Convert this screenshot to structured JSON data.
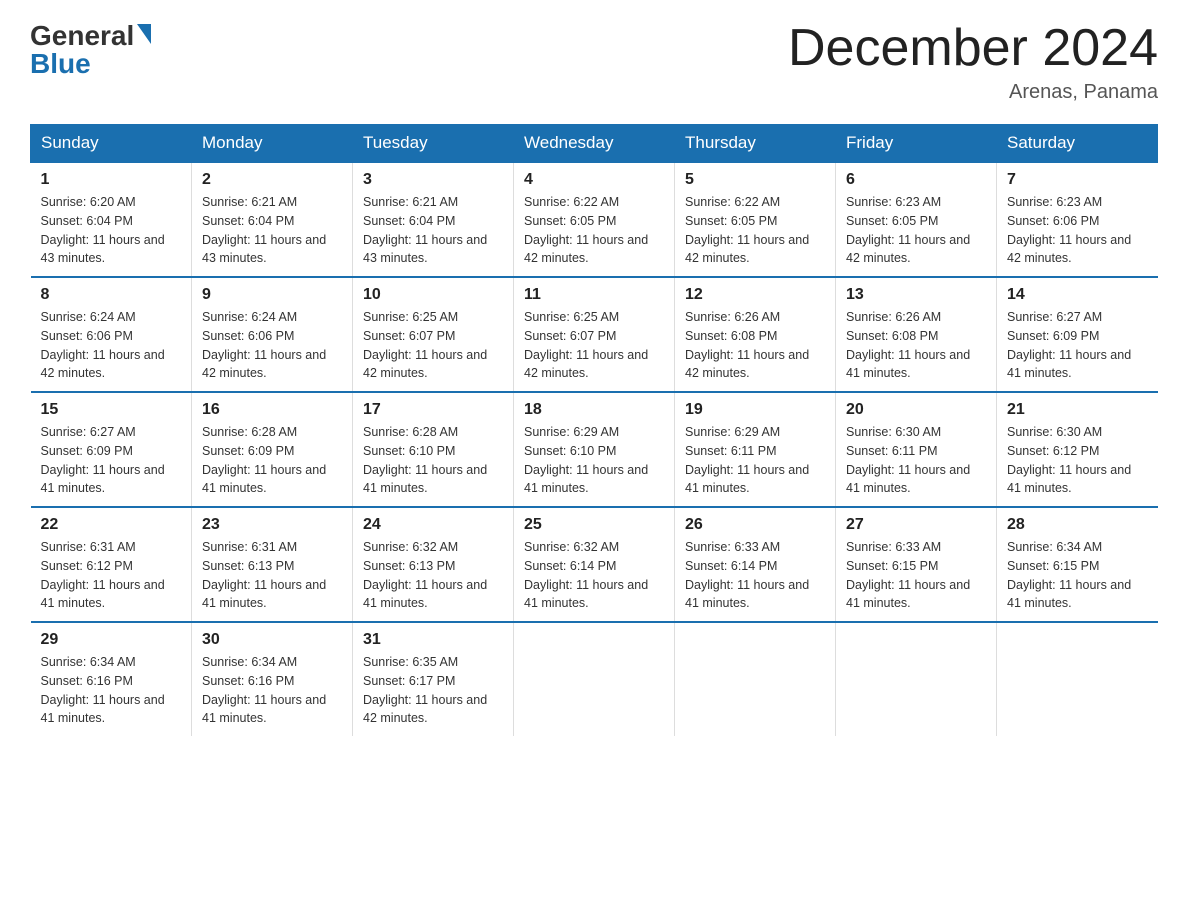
{
  "header": {
    "logo_general": "General",
    "logo_blue": "Blue",
    "title": "December 2024",
    "location": "Arenas, Panama"
  },
  "days_of_week": [
    "Sunday",
    "Monday",
    "Tuesday",
    "Wednesday",
    "Thursday",
    "Friday",
    "Saturday"
  ],
  "weeks": [
    [
      {
        "num": "1",
        "sunrise": "6:20 AM",
        "sunset": "6:04 PM",
        "daylight": "11 hours and 43 minutes."
      },
      {
        "num": "2",
        "sunrise": "6:21 AM",
        "sunset": "6:04 PM",
        "daylight": "11 hours and 43 minutes."
      },
      {
        "num": "3",
        "sunrise": "6:21 AM",
        "sunset": "6:04 PM",
        "daylight": "11 hours and 43 minutes."
      },
      {
        "num": "4",
        "sunrise": "6:22 AM",
        "sunset": "6:05 PM",
        "daylight": "11 hours and 42 minutes."
      },
      {
        "num": "5",
        "sunrise": "6:22 AM",
        "sunset": "6:05 PM",
        "daylight": "11 hours and 42 minutes."
      },
      {
        "num": "6",
        "sunrise": "6:23 AM",
        "sunset": "6:05 PM",
        "daylight": "11 hours and 42 minutes."
      },
      {
        "num": "7",
        "sunrise": "6:23 AM",
        "sunset": "6:06 PM",
        "daylight": "11 hours and 42 minutes."
      }
    ],
    [
      {
        "num": "8",
        "sunrise": "6:24 AM",
        "sunset": "6:06 PM",
        "daylight": "11 hours and 42 minutes."
      },
      {
        "num": "9",
        "sunrise": "6:24 AM",
        "sunset": "6:06 PM",
        "daylight": "11 hours and 42 minutes."
      },
      {
        "num": "10",
        "sunrise": "6:25 AM",
        "sunset": "6:07 PM",
        "daylight": "11 hours and 42 minutes."
      },
      {
        "num": "11",
        "sunrise": "6:25 AM",
        "sunset": "6:07 PM",
        "daylight": "11 hours and 42 minutes."
      },
      {
        "num": "12",
        "sunrise": "6:26 AM",
        "sunset": "6:08 PM",
        "daylight": "11 hours and 42 minutes."
      },
      {
        "num": "13",
        "sunrise": "6:26 AM",
        "sunset": "6:08 PM",
        "daylight": "11 hours and 41 minutes."
      },
      {
        "num": "14",
        "sunrise": "6:27 AM",
        "sunset": "6:09 PM",
        "daylight": "11 hours and 41 minutes."
      }
    ],
    [
      {
        "num": "15",
        "sunrise": "6:27 AM",
        "sunset": "6:09 PM",
        "daylight": "11 hours and 41 minutes."
      },
      {
        "num": "16",
        "sunrise": "6:28 AM",
        "sunset": "6:09 PM",
        "daylight": "11 hours and 41 minutes."
      },
      {
        "num": "17",
        "sunrise": "6:28 AM",
        "sunset": "6:10 PM",
        "daylight": "11 hours and 41 minutes."
      },
      {
        "num": "18",
        "sunrise": "6:29 AM",
        "sunset": "6:10 PM",
        "daylight": "11 hours and 41 minutes."
      },
      {
        "num": "19",
        "sunrise": "6:29 AM",
        "sunset": "6:11 PM",
        "daylight": "11 hours and 41 minutes."
      },
      {
        "num": "20",
        "sunrise": "6:30 AM",
        "sunset": "6:11 PM",
        "daylight": "11 hours and 41 minutes."
      },
      {
        "num": "21",
        "sunrise": "6:30 AM",
        "sunset": "6:12 PM",
        "daylight": "11 hours and 41 minutes."
      }
    ],
    [
      {
        "num": "22",
        "sunrise": "6:31 AM",
        "sunset": "6:12 PM",
        "daylight": "11 hours and 41 minutes."
      },
      {
        "num": "23",
        "sunrise": "6:31 AM",
        "sunset": "6:13 PM",
        "daylight": "11 hours and 41 minutes."
      },
      {
        "num": "24",
        "sunrise": "6:32 AM",
        "sunset": "6:13 PM",
        "daylight": "11 hours and 41 minutes."
      },
      {
        "num": "25",
        "sunrise": "6:32 AM",
        "sunset": "6:14 PM",
        "daylight": "11 hours and 41 minutes."
      },
      {
        "num": "26",
        "sunrise": "6:33 AM",
        "sunset": "6:14 PM",
        "daylight": "11 hours and 41 minutes."
      },
      {
        "num": "27",
        "sunrise": "6:33 AM",
        "sunset": "6:15 PM",
        "daylight": "11 hours and 41 minutes."
      },
      {
        "num": "28",
        "sunrise": "6:34 AM",
        "sunset": "6:15 PM",
        "daylight": "11 hours and 41 minutes."
      }
    ],
    [
      {
        "num": "29",
        "sunrise": "6:34 AM",
        "sunset": "6:16 PM",
        "daylight": "11 hours and 41 minutes."
      },
      {
        "num": "30",
        "sunrise": "6:34 AM",
        "sunset": "6:16 PM",
        "daylight": "11 hours and 41 minutes."
      },
      {
        "num": "31",
        "sunrise": "6:35 AM",
        "sunset": "6:17 PM",
        "daylight": "11 hours and 42 minutes."
      },
      null,
      null,
      null,
      null
    ]
  ]
}
